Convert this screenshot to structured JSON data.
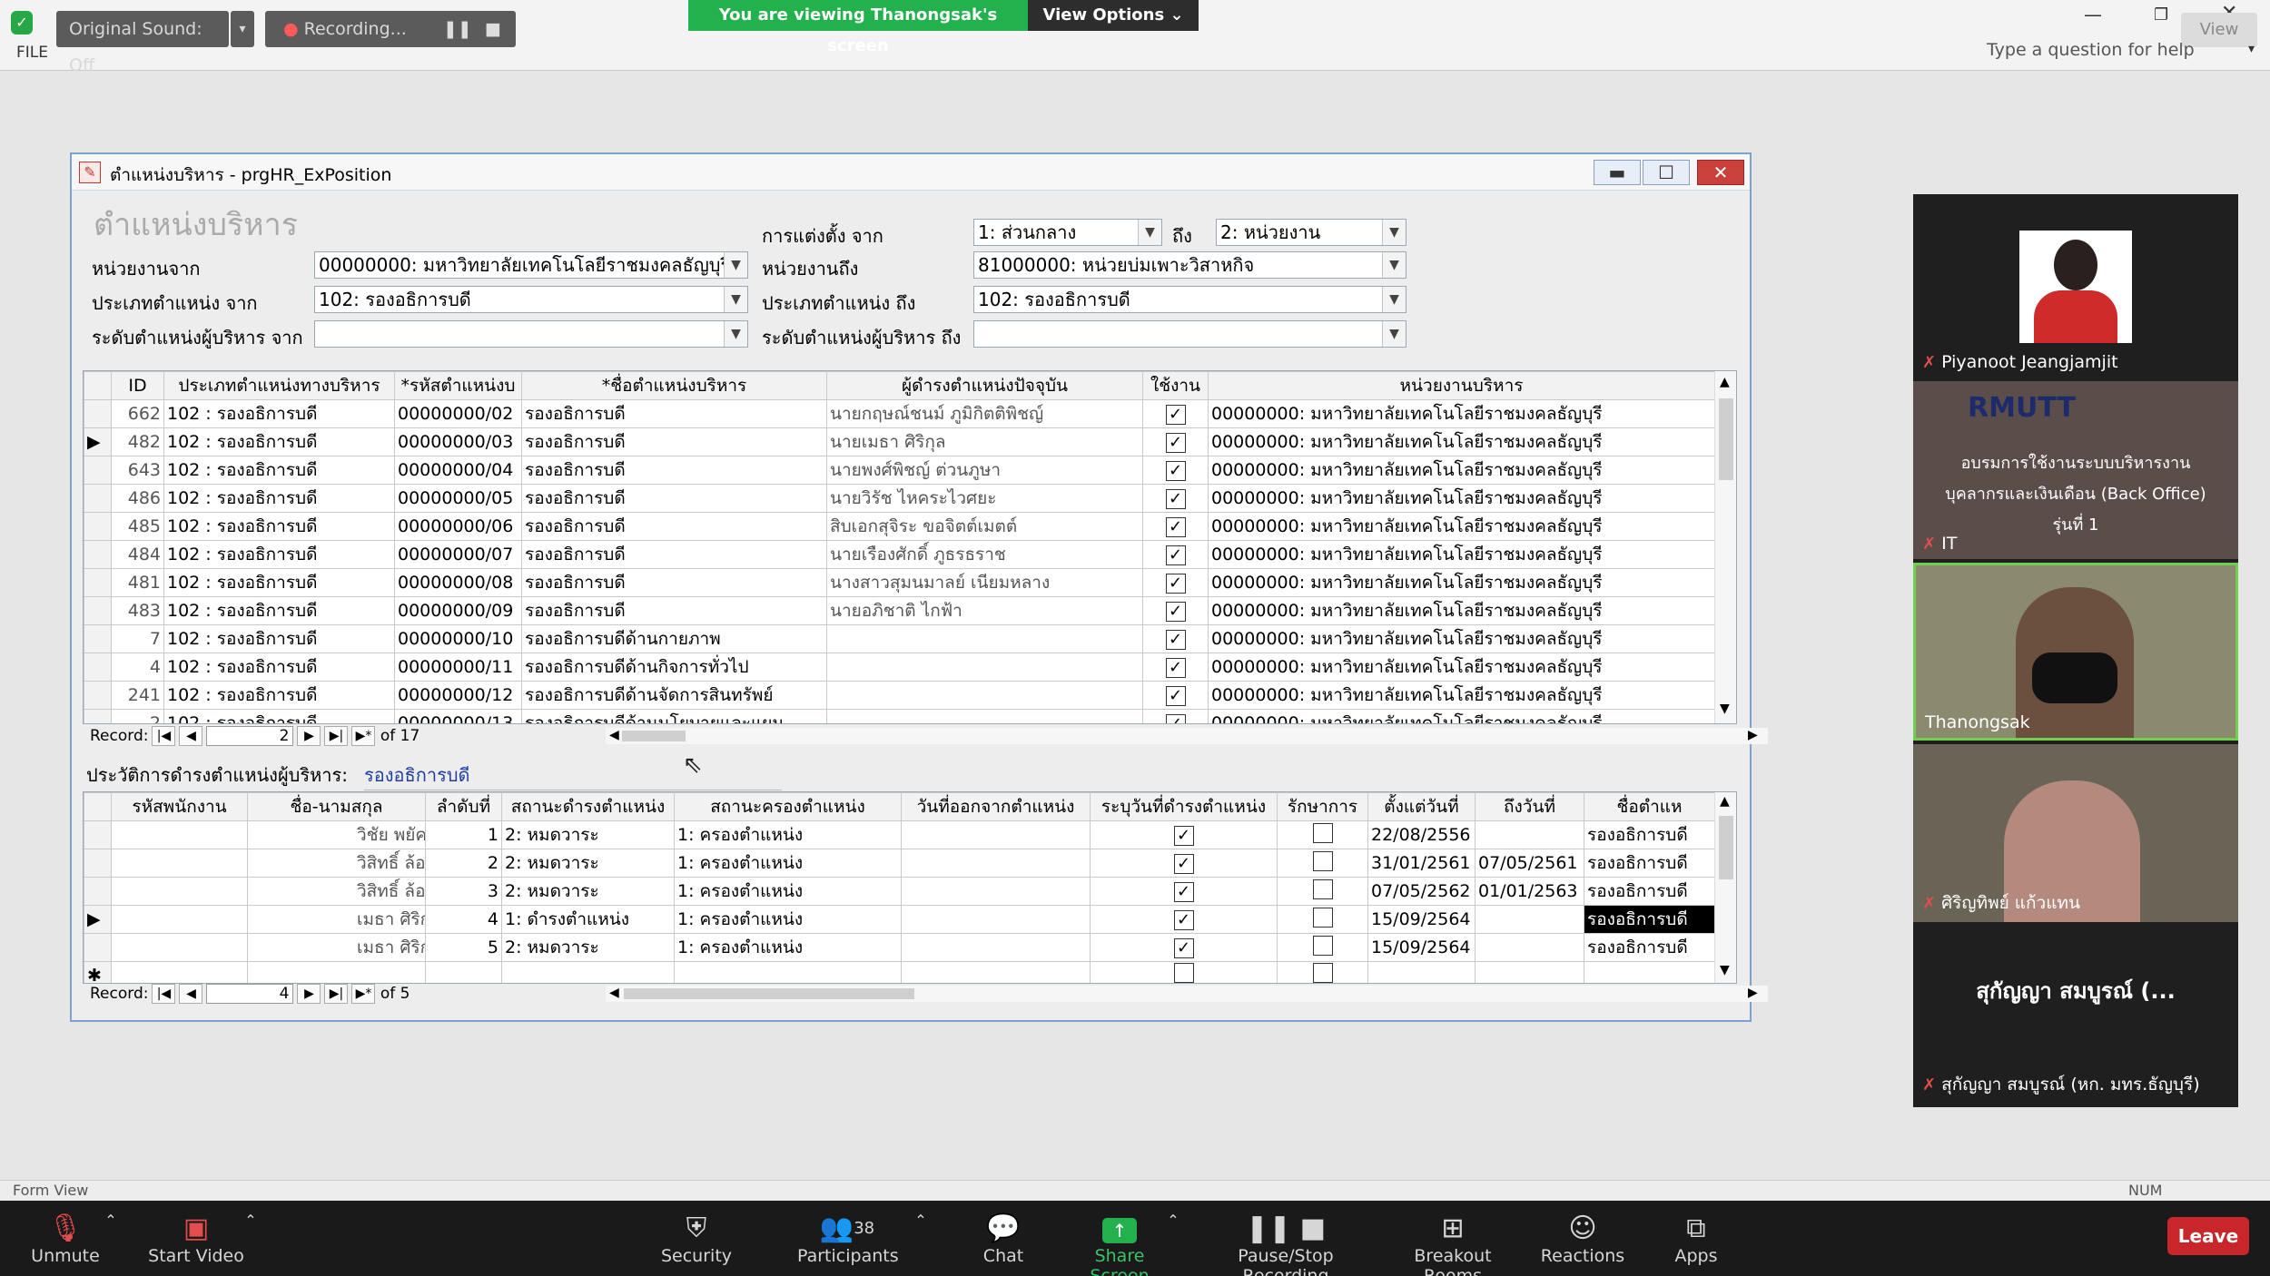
{
  "zoom": {
    "original_sound": "Original Sound: Off",
    "recording": "Recording...",
    "viewing": "You are viewing Thanongsak's screen",
    "view_options": "View Options ⌄",
    "help_placeholder": "Type a question for help",
    "file_tab": "FILE",
    "view_btn": "View",
    "status_left": "Form View",
    "status_right": "NUM"
  },
  "window": {
    "title": "ตำแหน่งบริหาร - prgHR_ExPosition",
    "heading": "ตำแหน่งบริหาร"
  },
  "filters": {
    "unit_from_label": "หน่วยงานจาก",
    "unit_from": "00000000: มหาวิทยาลัยเทคโนโลยีราชมงคลธัญบุรี",
    "type_from_label": "ประเภทตำแหน่ง จาก",
    "type_from": "102: รองอธิการบดี",
    "level_from_label": "ระดับตำแหน่งผู้บริหาร จาก",
    "level_from": "",
    "appoint_label": "การแต่งตั้ง จาก",
    "appoint_from": "1: ส่วนกลาง",
    "to_word": "ถึง",
    "appoint_to": "2: หน่วยงาน",
    "unit_to_label": "หน่วยงานถึง",
    "unit_to": "81000000: หน่วยบ่มเพาะวิสาหกิจ",
    "type_to_label": "ประเภทตำแหน่ง ถึง",
    "type_to": "102: รองอธิการบดี",
    "level_to_label": "ระดับตำแหน่งผู้บริหาร ถึง",
    "level_to": ""
  },
  "grid1": {
    "headers": [
      "ID",
      "ประเภทตำแหน่งทางบริหาร",
      "*รหัสตำแหน่งบ",
      "*ชื่อตำแหน่งบริหาร",
      "ผู้ดำรงตำแหน่งปัจจุบัน",
      "ใช้งาน",
      "หน่วยงานบริหาร"
    ],
    "rows": [
      [
        "662",
        "102 : รองอธิการบดี",
        "00000000/02",
        "รองอธิการบดี",
        "นายกฤษณ์ชนม์ ภูมิกิตติพิชญ์",
        "✓",
        "00000000: มหาวิทยาลัยเทคโนโลยีราชมงคลธัญบุรี"
      ],
      [
        "482",
        "102 : รองอธิการบดี",
        "00000000/03",
        "รองอธิการบดี",
        "นายเมธา ศิริกุล",
        "✓",
        "00000000: มหาวิทยาลัยเทคโนโลยีราชมงคลธัญบุรี"
      ],
      [
        "643",
        "102 : รองอธิการบดี",
        "00000000/04",
        "รองอธิการบดี",
        "นายพงศ์พิชญ์ ต่วนภูษา",
        "✓",
        "00000000: มหาวิทยาลัยเทคโนโลยีราชมงคลธัญบุรี"
      ],
      [
        "486",
        "102 : รองอธิการบดี",
        "00000000/05",
        "รองอธิการบดี",
        "นายวิรัช ไหคระไวศยะ",
        "✓",
        "00000000: มหาวิทยาลัยเทคโนโลยีราชมงคลธัญบุรี"
      ],
      [
        "485",
        "102 : รองอธิการบดี",
        "00000000/06",
        "รองอธิการบดี",
        "สิบเอกสุจิระ ขอจิตต์เมตต์",
        "✓",
        "00000000: มหาวิทยาลัยเทคโนโลยีราชมงคลธัญบุรี"
      ],
      [
        "484",
        "102 : รองอธิการบดี",
        "00000000/07",
        "รองอธิการบดี",
        "นายเรืองศักดิ์ ภูธรธราช",
        "✓",
        "00000000: มหาวิทยาลัยเทคโนโลยีราชมงคลธัญบุรี"
      ],
      [
        "481",
        "102 : รองอธิการบดี",
        "00000000/08",
        "รองอธิการบดี",
        "นางสาวสุมนมาลย์ เนียมหลาง",
        "✓",
        "00000000: มหาวิทยาลัยเทคโนโลยีราชมงคลธัญบุรี"
      ],
      [
        "483",
        "102 : รองอธิการบดี",
        "00000000/09",
        "รองอธิการบดี",
        "นายอภิชาติ ไกฟ้า",
        "✓",
        "00000000: มหาวิทยาลัยเทคโนโลยีราชมงคลธัญบุรี"
      ],
      [
        "7",
        "102 : รองอธิการบดี",
        "00000000/10",
        "รองอธิการบดีด้านกายภาพ",
        "",
        "✓",
        "00000000: มหาวิทยาลัยเทคโนโลยีราชมงคลธัญบุรี"
      ],
      [
        "4",
        "102 : รองอธิการบดี",
        "00000000/11",
        "รองอธิการบดีด้านกิจการทั่วไป",
        "",
        "✓",
        "00000000: มหาวิทยาลัยเทคโนโลยีราชมงคลธัญบุรี"
      ],
      [
        "241",
        "102 : รองอธิการบดี",
        "00000000/12",
        "รองอธิการบดีด้านจัดการสินทรัพย์",
        "",
        "✓",
        "00000000: มหาวิทยาลัยเทคโนโลยีราชมงคลธัญบุรี"
      ],
      [
        "2",
        "102 : รองอธิการบดี",
        "00000000/13",
        "รองอธิการบดีด้านนโยบายและแผน",
        "",
        "✓",
        "00000000: มหาวิทยาลัยเทคโนโลยีราชมงคลธัญบุรี"
      ]
    ],
    "record_label": "Record:",
    "record_current": "2",
    "record_of": "of 17"
  },
  "history": {
    "label": "ประวัติการดำรงตำแหน่งผู้บริหาร:",
    "value": "รองอธิการบดี"
  },
  "grid2": {
    "headers": [
      "รหัสพนักงาน",
      "ชื่อ-นามสกุล",
      "ลำดับที่",
      "สถานะดำรงตำแหน่ง",
      "สถานะครองตำแหน่ง",
      "วันที่ออกจากตำแหน่ง",
      "ระบุวันที่ดำรงตำแหน่ง",
      "รักษาการ",
      "ตั้งแต่วันที่",
      "ถึงวันที่",
      "ชื่อตำแห"
    ],
    "rows": [
      [
        "",
        "วิชัย พยัคฆโส",
        "1",
        "2: หมดวาระ",
        "1: ครองตำแหน่ง",
        "",
        "✓",
        "",
        "22/08/2556",
        "",
        "รองอธิการบดี"
      ],
      [
        "",
        "วิสิทธิ์ ล้อธรรมจักร",
        "2",
        "2: หมดวาระ",
        "1: ครองตำแหน่ง",
        "",
        "✓",
        "",
        "31/01/2561",
        "07/05/2561",
        "รองอธิการบดี"
      ],
      [
        "",
        "วิสิทธิ์ ล้อธรรมจักร",
        "3",
        "2: หมดวาระ",
        "1: ครองตำแหน่ง",
        "",
        "✓",
        "",
        "07/05/2562",
        "01/01/2563",
        "รองอธิการบดี"
      ],
      [
        "",
        "เมธา ศิริกุล",
        "4",
        "1: ดำรงตำแหน่ง",
        "1: ครองตำแหน่ง",
        "",
        "✓",
        "",
        "15/09/2564",
        "",
        "รองอธิการบดี"
      ],
      [
        "",
        "เมธา ศิริกุล",
        "5",
        "2: หมดวาระ",
        "1: ครองตำแหน่ง",
        "",
        "✓",
        "",
        "15/09/2564",
        "",
        "รองอธิการบดี"
      ]
    ],
    "record_label": "Record:",
    "record_current": "4",
    "record_of": "of 5"
  },
  "participants": [
    {
      "name": "Piyanoot Jeangjamjit"
    },
    {
      "name": "IT",
      "slide_line1": "อบรมการใช้งานระบบบริหารงาน",
      "slide_line2": "บุคลากรและเงินเดือน (Back Office)",
      "slide_line3": "รุ่นที่ 1",
      "logo": "RMUTT"
    },
    {
      "name": "Thanongsak"
    },
    {
      "name": "ศิริญทิพย์ แก้วแทน"
    },
    {
      "name": "สุกัญญา สมบูรณ์ (หก. มทร.ธัญบุรี)",
      "big_label": "สุกัญญา สมบูรณ์ (..."
    }
  ],
  "toolbar": {
    "unmute": "Unmute",
    "start_video": "Start Video",
    "security": "Security",
    "participants": "Participants",
    "participants_count": "38",
    "chat": "Chat",
    "share_screen": "Share Screen",
    "pause_rec": "Pause/Stop Recording",
    "breakout": "Breakout Rooms",
    "reactions": "Reactions",
    "apps": "Apps",
    "leave": "Leave"
  }
}
